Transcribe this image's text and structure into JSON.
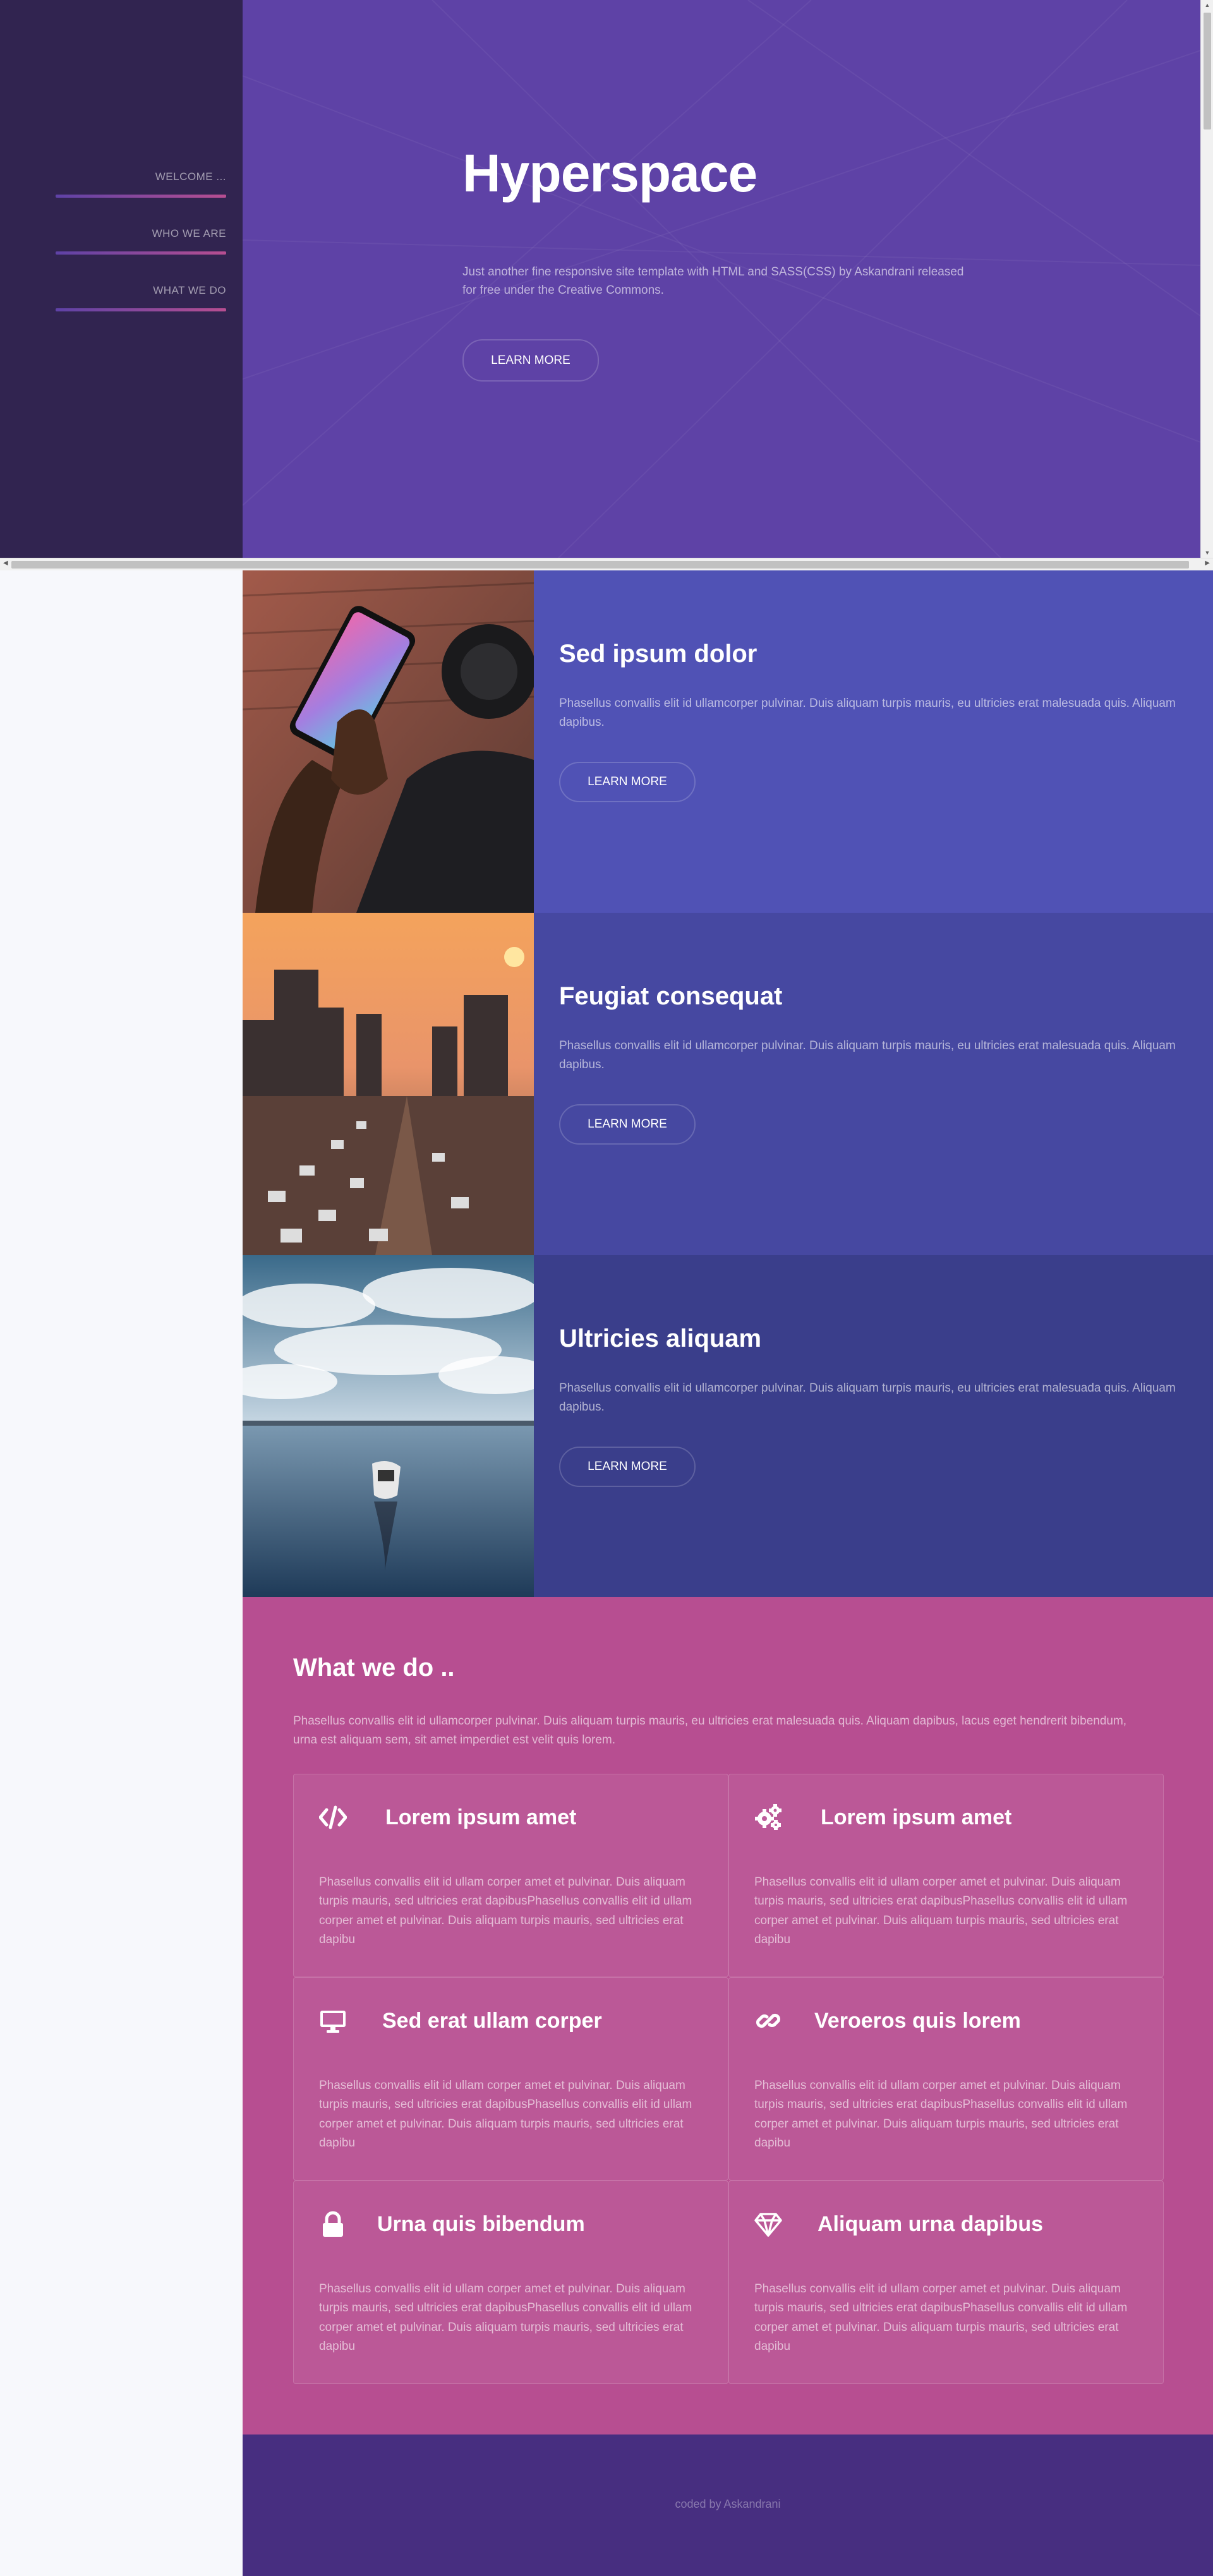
{
  "sidebar": {
    "items": [
      {
        "label": "WELCOME ..."
      },
      {
        "label": "WHO WE ARE"
      },
      {
        "label": "WHAT WE DO"
      }
    ]
  },
  "hero": {
    "title": "Hyperspace",
    "text": "Just another fine responsive site template with HTML and SASS(CSS) by Askandrani released for free under the Creative Commons.",
    "button": "LEARN MORE"
  },
  "spotlights": [
    {
      "title": "Sed ipsum dolor",
      "text": "Phasellus convallis elit id ullamcorper pulvinar. Duis aliquam turpis mauris, eu ultricies erat malesuada quis. Aliquam dapibus.",
      "button": "LEARN MORE",
      "color": "#5052b5",
      "image": "phone-photo"
    },
    {
      "title": "Feugiat consequat",
      "text": "Phasellus convallis elit id ullamcorper pulvinar. Duis aliquam turpis mauris, eu ultricies erat malesuada quis. Aliquam dapibus.",
      "button": "LEARN MORE",
      "color": "#4648a1",
      "image": "city-traffic-photo"
    },
    {
      "title": "Ultricies aliquam",
      "text": "Phasellus convallis elit id ullamcorper pulvinar. Duis aliquam turpis mauris, eu ultricies erat malesuada quis. Aliquam dapibus.",
      "button": "LEARN MORE",
      "color": "#3a3e8b",
      "image": "boat-lake-photo"
    }
  ],
  "what_we_do": {
    "title": "What we do ..",
    "text": "Phasellus convallis elit id ullamcorper pulvinar. Duis aliquam turpis mauris, eu ultricies erat malesuada quis. Aliquam dapibus, lacus eget hendrerit bibendum, urna est aliquam sem, sit amet imperdiet est velit quis lorem.",
    "features": [
      {
        "icon": "code-icon",
        "title": "Lorem ipsum amet",
        "text": "Phasellus convallis elit id ullam corper amet et pulvinar. Duis aliquam turpis mauris, sed ultricies erat dapibusPhasellus convallis elit id ullam corper amet et pulvinar. Duis aliquam turpis mauris, sed ultricies erat dapibu"
      },
      {
        "icon": "cogs-icon",
        "title": "Lorem ipsum amet",
        "text": "Phasellus convallis elit id ullam corper amet et pulvinar. Duis aliquam turpis mauris, sed ultricies erat dapibusPhasellus convallis elit id ullam corper amet et pulvinar. Duis aliquam turpis mauris, sed ultricies erat dapibu"
      },
      {
        "icon": "desktop-icon",
        "title": "Sed erat ullam corper",
        "text": "Phasellus convallis elit id ullam corper amet et pulvinar. Duis aliquam turpis mauris, sed ultricies erat dapibusPhasellus convallis elit id ullam corper amet et pulvinar. Duis aliquam turpis mauris, sed ultricies erat dapibu"
      },
      {
        "icon": "link-icon",
        "title": "Veroeros quis lorem",
        "text": "Phasellus convallis elit id ullam corper amet et pulvinar. Duis aliquam turpis mauris, sed ultricies erat dapibusPhasellus convallis elit id ullam corper amet et pulvinar. Duis aliquam turpis mauris, sed ultricies erat dapibu"
      },
      {
        "icon": "lock-icon",
        "title": "Urna quis bibendum",
        "text": "Phasellus convallis elit id ullam corper amet et pulvinar. Duis aliquam turpis mauris, sed ultricies erat dapibusPhasellus convallis elit id ullam corper amet et pulvinar. Duis aliquam turpis mauris, sed ultricies erat dapibu"
      },
      {
        "icon": "diamond-icon",
        "title": "Aliquam urna dapibus",
        "text": "Phasellus convallis elit id ullam corper amet et pulvinar. Duis aliquam turpis mauris, sed ultricies erat dapibusPhasellus convallis elit id ullam corper amet et pulvinar. Duis aliquam turpis mauris, sed ultricies erat dapibu"
      }
    ]
  },
  "footer": {
    "text": "coded by Askandrani"
  },
  "colors": {
    "sidebar": "#312450",
    "hero": "#5e42a6",
    "what_we_do": "#b74e91",
    "footer": "#472e80"
  }
}
